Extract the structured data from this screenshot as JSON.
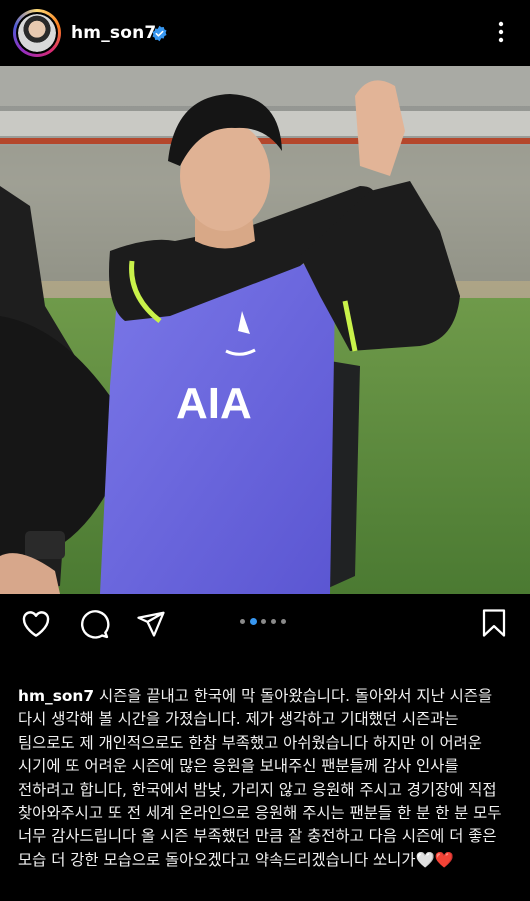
{
  "header": {
    "username": "hm_son7",
    "verified_icon": "verified-badge-icon",
    "more_icon": "more-options-icon"
  },
  "post": {
    "image_icon": "post-photo",
    "carousel": {
      "total": 5,
      "current": 1
    },
    "actions": {
      "like_icon": "heart-icon",
      "comment_icon": "comment-icon",
      "share_icon": "send-icon",
      "save_icon": "bookmark-icon"
    },
    "shirt_text": "AIA"
  },
  "caption": {
    "username": "hm_son7",
    "text": " 시즌을 끝내고 한국에 막 돌아왔습니다. 돌아와서 지난 시즌을 다시 생각해 볼 시간을 가졌습니다. 제가 생각하고 기대했던 시즌과는 팀으로도 제 개인적으로도 한참 부족했고 아쉬웠습니다 하지만 이 어려운 시기에 또 어려운 시즌에 많은 응원을 보내주신 팬분들께 감사 인사를 전하려고 합니다, 한국에서 밤낮, 가리지 않고 응원해 주시고 경기장에 직접 찾아와주시고 또 전 세계 온라인으로 응원해 주시는 팬분들 한 분 한 분 모두 너무 감사드립니다 올 시즌 부족했던 만큼 잘 충전하고 다음 시즌에 더 좋은 모습 더 강한 모습으로 돌아오겠다고 약속드리겠습니다 쏘니가🤍❤️"
  },
  "colors": {
    "background": "#000000",
    "verified": "#3897f0",
    "active_dot": "#3897f0"
  }
}
